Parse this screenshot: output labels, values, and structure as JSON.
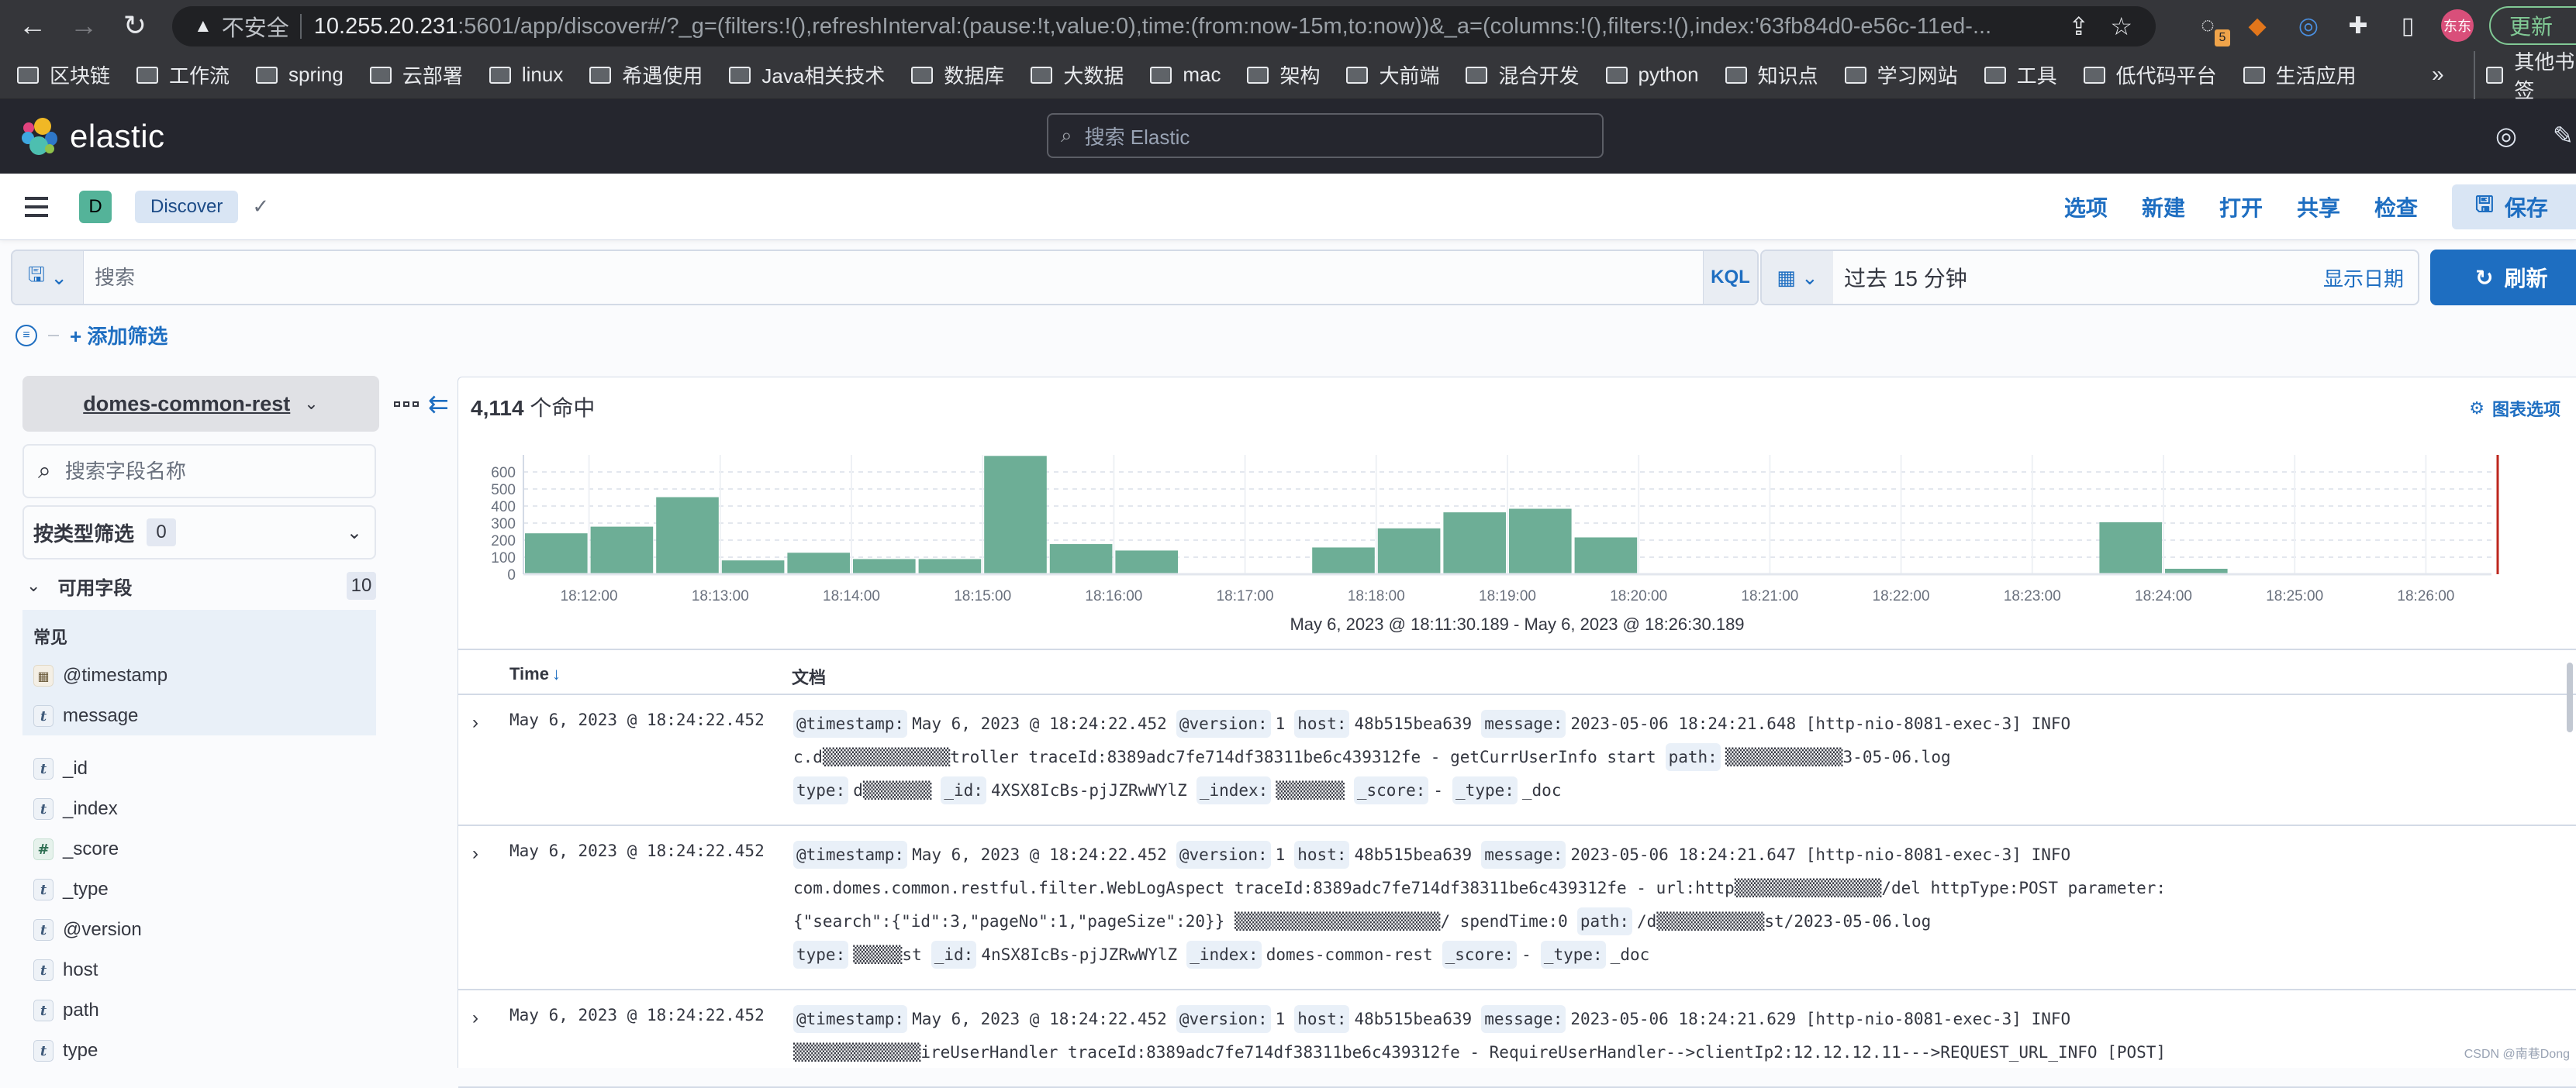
{
  "browser": {
    "url_insecure_label": "不安全",
    "url_host": "10.255.20.231",
    "url_rest": ":5601/app/discover#/?_g=(filters:!(),refreshInterval:(pause:!t,value:0),time:(from:now-15m,to:now))&_a=(columns:!(),filters:!(),index:'63fb84d0-e56c-11ed-...",
    "profile_label": "东东",
    "update_label": "更新",
    "extension_badge": "5",
    "bookmarks": [
      "区块链",
      "工作流",
      "spring",
      "云部署",
      "linux",
      "希遇使用",
      "Java相关技术",
      "数据库",
      "大数据",
      "mac",
      "架构",
      "大前端",
      "混合开发",
      "python",
      "知识点",
      "学习网站",
      "工具",
      "低代码平台",
      "生活应用"
    ],
    "bookmarks_more": "»",
    "bookmarks_other": "其他书签"
  },
  "header": {
    "logo_text": "elastic",
    "search_placeholder": "搜索 Elastic"
  },
  "app_bar": {
    "space_initial": "D",
    "breadcrumb": "Discover",
    "links": [
      "选项",
      "新建",
      "打开",
      "共享",
      "检查"
    ],
    "save_label": "保存"
  },
  "query": {
    "placeholder": "搜索",
    "language": "KQL",
    "time_range": "过去 15 分钟",
    "show_dates": "显示日期",
    "refresh_label": "刷新",
    "add_filter": "+ 添加筛选"
  },
  "sidebar": {
    "index_pattern": "domes-common-rest",
    "field_search_placeholder": "搜索字段名称",
    "type_filter_label": "按类型筛选",
    "type_filter_count": "0",
    "available_label": "可用字段",
    "available_count": "10",
    "popular_title": "常见",
    "popular_fields": [
      {
        "name": "@timestamp",
        "type": "date"
      },
      {
        "name": "message",
        "type": "string"
      }
    ],
    "fields": [
      {
        "name": "_id",
        "type": "string"
      },
      {
        "name": "_index",
        "type": "string"
      },
      {
        "name": "_score",
        "type": "number"
      },
      {
        "name": "_type",
        "type": "string"
      },
      {
        "name": "@version",
        "type": "string"
      },
      {
        "name": "host",
        "type": "string"
      },
      {
        "name": "path",
        "type": "string"
      },
      {
        "name": "type",
        "type": "string"
      }
    ]
  },
  "results": {
    "hit_count": "4,114",
    "hit_suffix": "个命中",
    "chart_options": "图表选项",
    "range_label": "May 6, 2023 @ 18:11:30.189 - May 6, 2023 @ 18:26:30.189"
  },
  "chart_data": {
    "type": "bar",
    "title": "",
    "xlabel": "May 6, 2023 @ 18:11:30.189 - May 6, 2023 @ 18:26:30.189",
    "ylabel": "",
    "interval": "30s",
    "categories": [
      "18:11:30",
      "18:12:00",
      "18:12:30",
      "18:13:00",
      "18:13:30",
      "18:14:00",
      "18:14:30",
      "18:15:00",
      "18:15:30",
      "18:16:00",
      "18:16:30",
      "18:17:00",
      "18:17:30",
      "18:18:00",
      "18:18:30",
      "18:19:00",
      "18:19:30",
      "18:20:00",
      "18:20:30",
      "18:21:00",
      "18:21:30",
      "18:22:00",
      "18:22:30",
      "18:23:00",
      "18:23:30",
      "18:24:00",
      "18:24:30",
      "18:25:00",
      "18:25:30",
      "18:26:00"
    ],
    "values": [
      240,
      279,
      452,
      81,
      126,
      89,
      89,
      694,
      177,
      139,
      0,
      0,
      157,
      269,
      363,
      384,
      216,
      0,
      0,
      0,
      0,
      0,
      0,
      0,
      305,
      32,
      0,
      0,
      0,
      0
    ],
    "x_ticks": [
      "18:12:00",
      "18:13:00",
      "18:14:00",
      "18:15:00",
      "18:16:00",
      "18:17:00",
      "18:18:00",
      "18:19:00",
      "18:20:00",
      "18:21:00",
      "18:22:00",
      "18:23:00",
      "18:24:00",
      "18:25:00",
      "18:26:00"
    ],
    "y_ticks": [
      0,
      100,
      200,
      300,
      400,
      500,
      600
    ],
    "ylim": [
      0,
      700
    ],
    "grid": true,
    "bar_color": "#6dae96",
    "now_marker_color": "#bd271e"
  },
  "table": {
    "col_time": "Time",
    "col_time_sort": "↓",
    "col_doc": "文档",
    "rows": [
      {
        "time": "May 6, 2023 @ 18:24:22.452",
        "lines": [
          [
            {
              "k": "@timestamp:",
              "v": "May 6, 2023 @ 18:24:22.452"
            },
            {
              "k": "@version:",
              "v": "1"
            },
            {
              "k": "host:",
              "v": "48b515bea639"
            },
            {
              "k": "message:",
              "v": "2023-05-06 18:24:21.648 [http-nio-8081-exec-3] INFO"
            }
          ],
          [
            {
              "k": "",
              "v": "c.d▒▒▒▒▒▒▒▒▒▒▒▒▒troller traceId:8389adc7fe714df38311be6c439312fe - getCurrUserInfo start"
            },
            {
              "k": "path:",
              "v": "▒▒▒▒▒▒▒▒▒▒▒▒3-05-06.log"
            }
          ],
          [
            {
              "k": "type:",
              "v": "d▒▒▒▒▒▒▒"
            },
            {
              "k": "_id:",
              "v": "4XSX8IcBs-pjJZRwWYlZ"
            },
            {
              "k": "_index:",
              "v": "▒▒▒▒▒▒▒"
            },
            {
              "k": "_score:",
              "v": "-"
            },
            {
              "k": "_type:",
              "v": "_doc"
            }
          ]
        ]
      },
      {
        "time": "May 6, 2023 @ 18:24:22.452",
        "lines": [
          [
            {
              "k": "@timestamp:",
              "v": "May 6, 2023 @ 18:24:22.452"
            },
            {
              "k": "@version:",
              "v": "1"
            },
            {
              "k": "host:",
              "v": "48b515bea639"
            },
            {
              "k": "message:",
              "v": "2023-05-06 18:24:21.647 [http-nio-8081-exec-3] INFO"
            }
          ],
          [
            {
              "k": "",
              "v": "com.domes.common.restful.filter.WebLogAspect traceId:8389adc7fe714df38311be6c439312fe - url:http▒▒▒▒▒▒▒▒▒▒▒▒▒▒▒/del httpType:POST parameter:"
            }
          ],
          [
            {
              "k": "",
              "v": "{\"search\":{\"id\":3,\"pageNo\":1,\"pageSize\":20}} ▒▒▒▒▒▒▒▒▒▒▒▒▒▒▒▒▒▒▒▒▒/ spendTime:0"
            },
            {
              "k": "path:",
              "v": "/d▒▒▒▒▒▒▒▒▒▒▒st/2023-05-06.log"
            }
          ],
          [
            {
              "k": "type:",
              "v": "▒▒▒▒▒st"
            },
            {
              "k": "_id:",
              "v": "4nSX8IcBs-pjJZRwWYlZ"
            },
            {
              "k": "_index:",
              "v": "domes-common-rest"
            },
            {
              "k": "_score:",
              "v": "-"
            },
            {
              "k": "_type:",
              "v": "_doc"
            }
          ]
        ]
      },
      {
        "time": "May 6, 2023 @ 18:24:22.452",
        "lines": [
          [
            {
              "k": "@timestamp:",
              "v": "May 6, 2023 @ 18:24:22.452"
            },
            {
              "k": "@version:",
              "v": "1"
            },
            {
              "k": "host:",
              "v": "48b515bea639"
            },
            {
              "k": "message:",
              "v": "2023-05-06 18:24:21.629 [http-nio-8081-exec-3] INFO"
            }
          ],
          [
            {
              "k": "",
              "v": "▒▒▒▒▒▒▒▒▒▒▒▒▒ireUserHandler traceId:8389adc7fe714df38311be6c439312fe - RequireUserHandler-->clientIp2:12.12.12.11--->REQUEST_URL_INFO [POST]"
            }
          ]
        ]
      }
    ]
  },
  "watermark": "CSDN @南巷Dong"
}
